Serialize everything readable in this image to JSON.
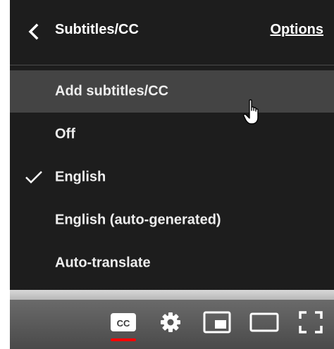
{
  "menu": {
    "title": "Subtitles/CC",
    "options_label": "Options",
    "items": [
      {
        "label": "Add subtitles/CC",
        "selected": false,
        "hover": true
      },
      {
        "label": "Off",
        "selected": false,
        "hover": false
      },
      {
        "label": "English",
        "selected": true,
        "hover": false
      },
      {
        "label": "English (auto-generated)",
        "selected": false,
        "hover": false
      },
      {
        "label": "Auto-translate",
        "selected": false,
        "hover": false
      }
    ]
  },
  "controls": {
    "icons": [
      "cc-icon",
      "settings-gear-icon",
      "miniplayer-icon",
      "theater-mode-icon",
      "fullscreen-icon"
    ],
    "cc_active": true,
    "accent": "#ff0000"
  }
}
